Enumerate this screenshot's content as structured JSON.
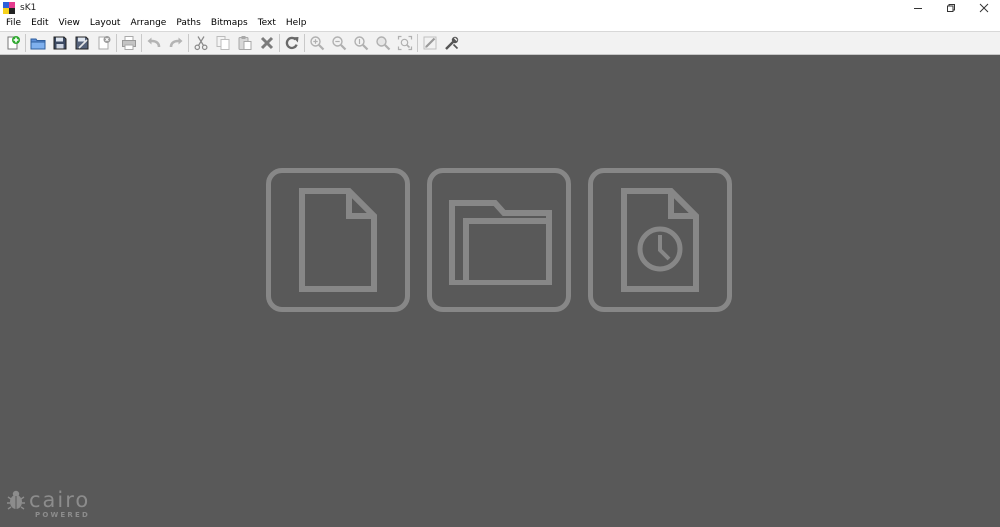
{
  "window": {
    "title": "sK1",
    "controls": {
      "minimize_icon": "minimize-icon",
      "maximize_icon": "restore-icon",
      "close_icon": "close-icon"
    }
  },
  "menubar": {
    "items": [
      {
        "label": "File"
      },
      {
        "label": "Edit"
      },
      {
        "label": "View"
      },
      {
        "label": "Layout"
      },
      {
        "label": "Arrange"
      },
      {
        "label": "Paths"
      },
      {
        "label": "Bitmaps"
      },
      {
        "label": "Text"
      },
      {
        "label": "Help"
      }
    ]
  },
  "toolbar": {
    "buttons": [
      {
        "icon": "new-document-icon",
        "enabled": true
      },
      {
        "icon": "open-folder-icon",
        "enabled": true
      },
      {
        "icon": "save-icon",
        "enabled": true
      },
      {
        "icon": "save-as-icon",
        "enabled": true
      },
      {
        "icon": "close-document-icon",
        "enabled": false
      },
      {
        "icon": "print-icon",
        "enabled": false
      },
      {
        "icon": "undo-icon",
        "enabled": false
      },
      {
        "icon": "redo-icon",
        "enabled": false
      },
      {
        "icon": "cut-icon",
        "enabled": false
      },
      {
        "icon": "copy-icon",
        "enabled": false
      },
      {
        "icon": "paste-icon",
        "enabled": false
      },
      {
        "icon": "delete-icon",
        "enabled": false
      },
      {
        "icon": "refresh-icon",
        "enabled": true
      },
      {
        "icon": "zoom-in-icon",
        "enabled": false
      },
      {
        "icon": "zoom-out-icon",
        "enabled": false
      },
      {
        "icon": "zoom-100-icon",
        "enabled": false
      },
      {
        "icon": "zoom-selected-icon",
        "enabled": false
      },
      {
        "icon": "zoom-page-icon",
        "enabled": false
      },
      {
        "icon": "edit-pen-icon",
        "enabled": false
      },
      {
        "icon": "preferences-tools-icon",
        "enabled": true
      }
    ]
  },
  "start_screen": {
    "tiles": [
      {
        "icon": "new-document-icon",
        "action": "new"
      },
      {
        "icon": "open-folder-icon",
        "action": "open"
      },
      {
        "icon": "recent-document-icon",
        "action": "recent"
      }
    ]
  },
  "branding": {
    "logo_word": "cairo",
    "logo_sub": "POWERED"
  },
  "colors": {
    "workspace_bg": "#595959",
    "tile_stroke": "#878787",
    "toolbar_bg": "#f2f2f2"
  }
}
